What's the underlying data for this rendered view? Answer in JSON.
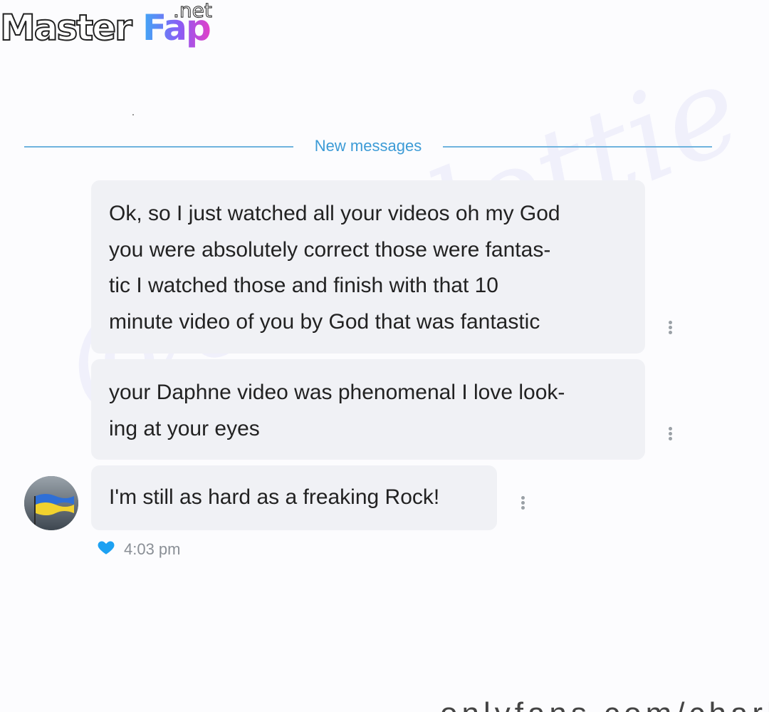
{
  "logo": {
    "master": "Master",
    "fap": "Fap",
    "net": ".net"
  },
  "chat": {
    "divider_label": "New messages",
    "messages": [
      {
        "text": "Ok, so I just watched all your videos oh my God\nyou were absolutely correct those were fantas-\ntic I watched those and finish with that 10\nminute video of you by God that was fantastic"
      },
      {
        "text": "your Daphne video was phenomenal I love look-\ning at your eyes"
      },
      {
        "text": "I'm still as hard as a freaking Rock!"
      }
    ],
    "timestamp": "4:03 pm",
    "reaction_icon": "heart-icon",
    "menu_icon": "more-vertical-icon",
    "reaction_color": "#1da1f2"
  },
  "watermark": {
    "text": "@charlottie"
  },
  "footer_fragment": {
    "text": "onlyfans.com/charlottii"
  }
}
